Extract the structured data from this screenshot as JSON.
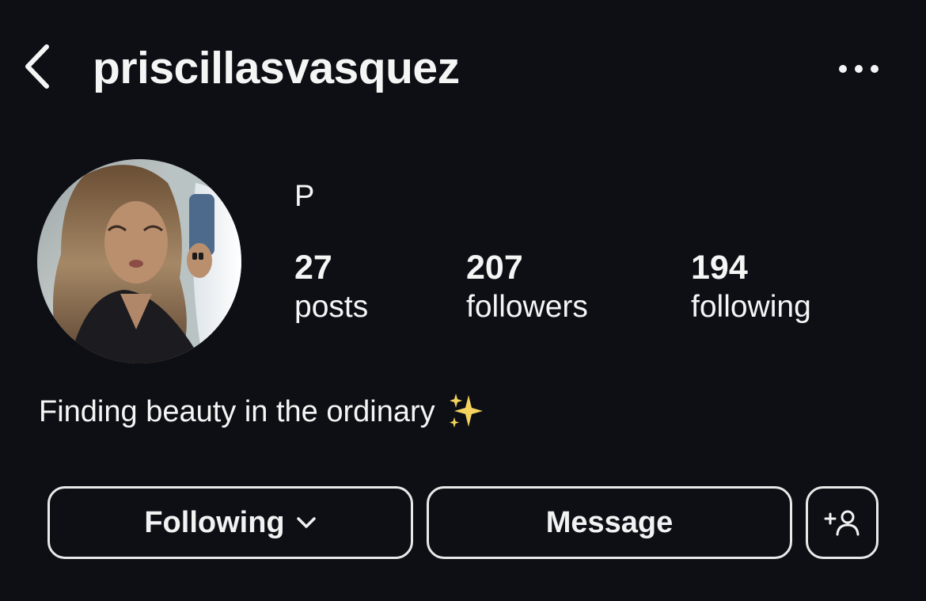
{
  "header": {
    "username": "priscillasvasquez",
    "back_icon": "chevron-left-icon",
    "more_icon": "more-horizontal-icon"
  },
  "profile": {
    "display_name": "P",
    "avatar_icon": "profile-photo",
    "stats": [
      {
        "value": "27",
        "label": "posts"
      },
      {
        "value": "207",
        "label": "followers"
      },
      {
        "value": "194",
        "label": "following"
      }
    ],
    "bio": "Finding beauty in the ordinary",
    "bio_emoji": "sparkles-icon"
  },
  "actions": {
    "following_label": "Following",
    "message_label": "Message",
    "add_user_icon": "add-user-icon"
  },
  "colors": {
    "background": "#0d0f14",
    "text": "#f5f5f5",
    "button_border": "#e9e9e9",
    "sparkle": "#f4d35e"
  }
}
